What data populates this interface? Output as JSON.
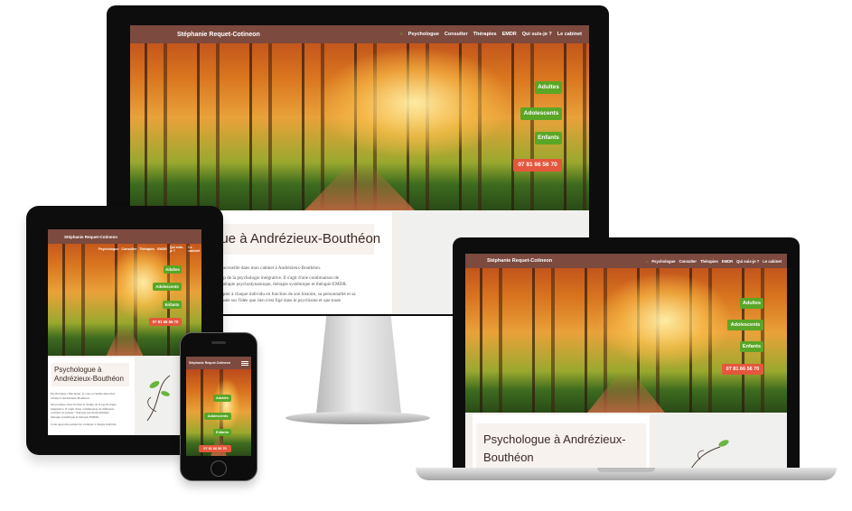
{
  "site": {
    "brand": "Stéphanie Requet-Cotineon",
    "nav": [
      "Psychologue",
      "Consulter",
      "Thérapies",
      "EMDR",
      "Qui suis-je ?",
      "Le cabinet"
    ],
    "nav_short": [
      "Psychologue",
      "Consulter",
      "Thérapies",
      "EMDR",
      "Qui suis-je ?",
      "Le cabinet"
    ],
    "buttons": {
      "adults": "Adultes",
      "teens": "Adolescents",
      "kids": "Enfants"
    },
    "phone": "07 81 66 56 70",
    "title": "Psychologue à Andrézieux-Bouthéon",
    "title_desktop_fragment": "gue à Andrézieux-Bouthéon",
    "title_laptop_line1": "Psychologue à Andrézieux-",
    "title_laptop_line2": "Bouthéon",
    "desktop_lines": [
      "vous accueille dans mon cabinet à Andrézieux-Bouthéon.",
      "champ de la psychologie intégrative. Il s'agit d'une combinaison de",
      "le : thérapie psychodynamique, thérapie systémique et thérapie EMDR.",
      "d'adapter à chaque individu en fonction de son histoire, sa personnalité et sa",
      "est basée sur l'idée que rien n'est figé dans le psychisme et que toute"
    ],
    "tablet_lines": [
      "Psychologue clinicienne, je vous accueille dans mon",
      "cabinet à Andrézieux-Bouthéon.",
      "Ma pratique s'inscrit dans le champ de la psychologie",
      "intégrative. Il s'agit d'une combinaison de différents",
      "courants de pensée : thérapie psychodynamique,",
      "thérapie systémique et thérapie EMDR.",
      "Cette approche permet de s'adapter à chaque individu"
    ]
  },
  "colors": {
    "navbar": "#7c4a3f",
    "green": "#5aa626",
    "red": "#e4573c",
    "device": "#111111"
  },
  "icons": {
    "home": "home-icon",
    "menu": "hamburger-menu-icon",
    "leaf": "leaf-decoration-icon"
  }
}
